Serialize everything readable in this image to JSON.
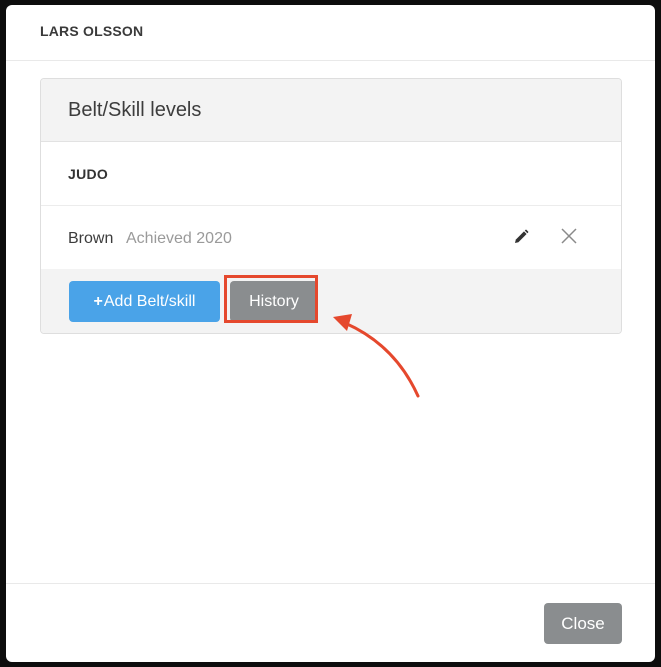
{
  "modal": {
    "title": "LARS OLSSON"
  },
  "card": {
    "title": "Belt/Skill levels",
    "section": "JUDO",
    "belt": {
      "name": "Brown",
      "achieved": "Achieved 2020",
      "edit_icon": "pencil-icon",
      "remove_icon": "close-icon"
    },
    "add_button": {
      "icon": "+",
      "label": "Add Belt/skill"
    },
    "history_button": {
      "label": "History"
    }
  },
  "footer": {
    "close_label": "Close"
  },
  "colors": {
    "primary": "#4aa3e8",
    "secondary": "#8a8d8f",
    "annotation": "#e5482d"
  }
}
